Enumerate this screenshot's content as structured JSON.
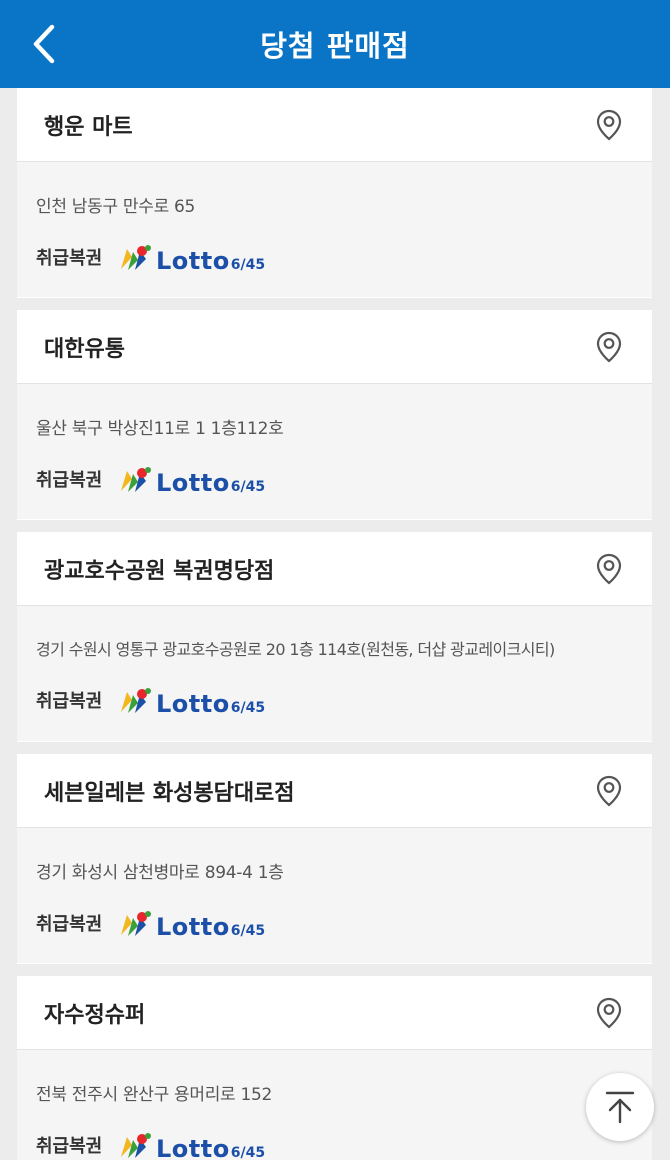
{
  "header": {
    "title": "당첨 판매점",
    "back_icon": "chevron-left-icon",
    "background": "#0a74c6"
  },
  "ticket_label": "취급복권",
  "logo": {
    "word": "Lotto",
    "sub": "6/45"
  },
  "stores": [
    {
      "name": "행운 마트",
      "address": "인천 남동구 만수로 65"
    },
    {
      "name": "대한유통",
      "address": "울산 북구 박상진11로 1 1층112호"
    },
    {
      "name": "광교호수공원 복권명당점",
      "address": "경기 수원시 영통구 광교호수공원로 20 1층 114호(원천동, 더샵 광교레이크시티)"
    },
    {
      "name": "세븐일레븐 화성봉담대로점",
      "address": "경기 화성시 삼천병마로 894-4 1층"
    },
    {
      "name": "자수정슈퍼",
      "address": "전북 전주시 완산구 용머리로 152"
    }
  ],
  "scroll_top_icon": "arrow-up-to-top-icon"
}
